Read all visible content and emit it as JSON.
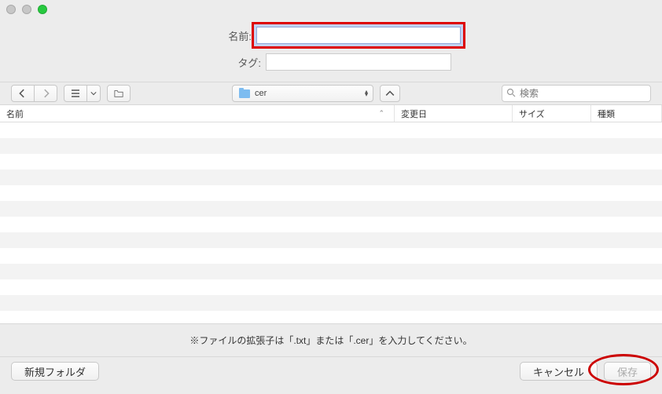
{
  "labels": {
    "name": "名前:",
    "tag": "タグ:"
  },
  "fields": {
    "name_value": "",
    "tag_value": ""
  },
  "toolbar": {
    "current_folder": "cer",
    "search_placeholder": "検索"
  },
  "columns": {
    "name": "名前",
    "date": "変更日",
    "size": "サイズ",
    "kind": "種類"
  },
  "hint": "※ファイルの拡張子は「.txt」または「.cer」を入力してください。",
  "buttons": {
    "new_folder": "新規フォルダ",
    "cancel": "キャンセル",
    "save": "保存"
  }
}
